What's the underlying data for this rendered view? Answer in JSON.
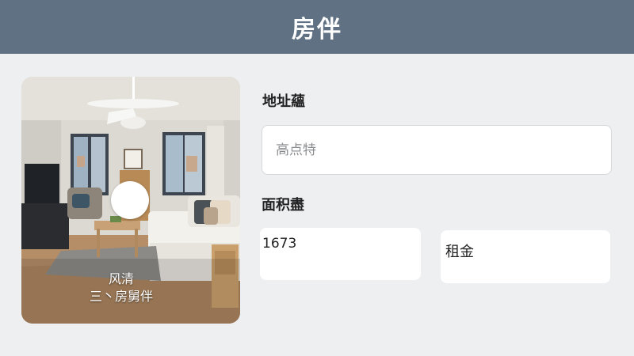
{
  "header": {
    "title": "房伴"
  },
  "photo": {
    "caption_line1": "风清",
    "caption_line2": "三丶房舅伴"
  },
  "form": {
    "address": {
      "label": "地址蘊",
      "placeholder": "高点特"
    },
    "area": {
      "label": "面积盡",
      "value": "1673"
    },
    "rent": {
      "label": "租金"
    }
  },
  "colors": {
    "header_bg": "#5f7182",
    "page_bg": "#eeeff1"
  }
}
